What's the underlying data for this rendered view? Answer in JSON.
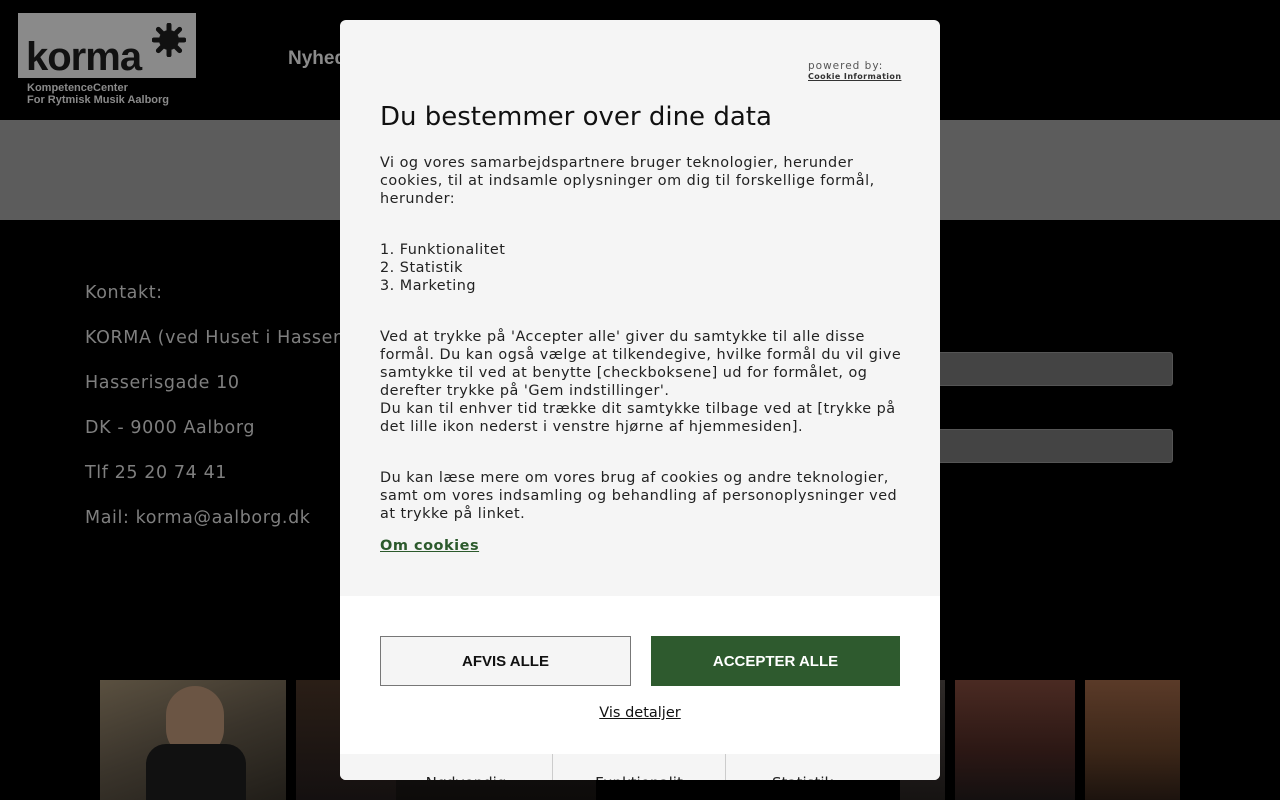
{
  "site": {
    "logo": {
      "word": "korma",
      "sub_line1": "KompetenceCenter",
      "sub_line2": "For Rytmisk Musik Aalborg"
    },
    "nav_partial": "Nyhed",
    "contact": [
      "Kontakt:",
      "KORMA (ved Huset i Hasser",
      "Hasserisgade 10",
      "DK - 9000 Aalborg",
      "Tlf 25 20 74 41",
      "Mail: korma@aalborg.dk"
    ]
  },
  "modal": {
    "powered_by": "powered by:",
    "powered_brand": "Cookie Information",
    "title": "Du bestemmer over dine data",
    "intro": "Vi og vores samarbejdspartnere bruger teknologier, herunder cookies, til at indsamle oplysninger om dig til forskellige formål, herunder:",
    "purposes": [
      "1. Funktionalitet",
      "2. Statistik",
      "3. Marketing"
    ],
    "consent_text_1": "Ved at trykke på 'Accepter alle' giver du samtykke til alle disse formål. Du kan også vælge at tilkendegive, hvilke formål du vil give samtykke til ved at benytte [checkboksene] ud for formålet, og derefter trykke på 'Gem indstillinger'.",
    "consent_text_2": "Du kan til enhver tid trække dit samtykke tilbage ved at [trykke på det lille ikon nederst i venstre hjørne af hjemmesiden].",
    "more_info": "Du kan læse mere om vores brug af cookies og andre teknologier, samt om vores indsamling og behandling af personoplysninger ved at trykke på linket.",
    "cookie_link": "Om cookies",
    "reject_label": "AFVIS ALLE",
    "accept_label": "ACCEPTER ALLE",
    "details_label": "Vis detaljer",
    "tabs": [
      "Nødvendig",
      "Funktionalit",
      "Statistik"
    ]
  },
  "colors": {
    "accent": "#2e5a2e",
    "modal_bg": "#f5f5f5",
    "page_bg": "#000000"
  }
}
